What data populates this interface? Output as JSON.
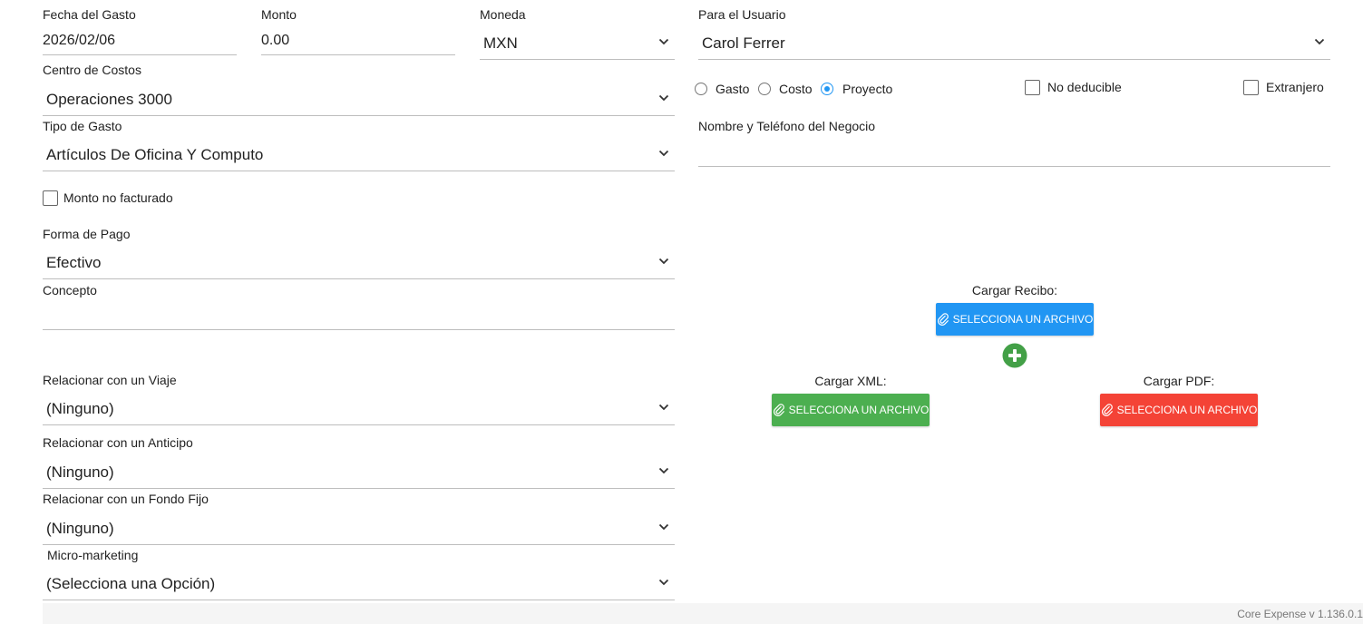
{
  "form": {
    "fecha_label": "Fecha del Gasto",
    "fecha_value": "2026/02/06",
    "monto_label": "Monto",
    "monto_value": "0.00",
    "moneda_label": "Moneda",
    "moneda_value": "MXN",
    "usuario_label": "Para el Usuario",
    "usuario_value": "Carol Ferrer",
    "centro_label": "Centro de Costos",
    "centro_value": "Operaciones 3000",
    "tipo_label": "Tipo de Gasto",
    "tipo_value": "Artículos De Oficina Y Computo",
    "no_facturado_label": "Monto no facturado",
    "forma_label": "Forma de Pago",
    "forma_value": "Efectivo",
    "concepto_label": "Concepto",
    "concepto_value": "",
    "viaje_label": "Relacionar con un Viaje",
    "viaje_value": "(Ninguno)",
    "anticipo_label": "Relacionar con un Anticipo",
    "anticipo_value": "(Ninguno)",
    "fondo_label": "Relacionar con un Fondo Fijo",
    "fondo_value": "(Ninguno)",
    "micro_label": "Micro-marketing",
    "micro_value": "(Selecciona una Opción)",
    "radio_gasto": "Gasto",
    "radio_costo": "Costo",
    "radio_proyecto": "Proyecto",
    "radio_selected": "Proyecto",
    "no_deducible_label": "No deducible",
    "extranjero_label": "Extranjero",
    "negocio_label": "Nombre y Teléfono del Negocio",
    "negocio_value": ""
  },
  "uploads": {
    "recibo_label": "Cargar Recibo:",
    "xml_label": "Cargar XML:",
    "pdf_label": "Cargar PDF:",
    "button_label": "SELECCIONA UN ARCHIVO",
    "colors": {
      "recibo": "#2196f3",
      "xml": "#4caf50",
      "pdf": "#f44336",
      "add": "#43a047"
    }
  },
  "footer": {
    "version": "Core Expense v 1.136.0.1"
  },
  "icons": {
    "chevron": "chevron-down-icon",
    "clip": "paperclip-icon",
    "add": "add-circle-icon"
  }
}
